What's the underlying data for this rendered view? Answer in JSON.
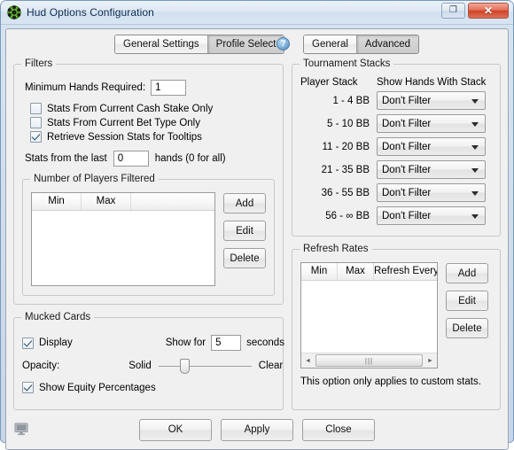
{
  "window": {
    "title": "Hud Options Configuration",
    "app_icon": "green-gear-icon",
    "restore_label": "❐",
    "close_label": "✕"
  },
  "tabs": {
    "left_group": [
      {
        "label": "General Settings",
        "selected": false
      },
      {
        "label": "Profile Select",
        "selected": true
      }
    ],
    "right_group": [
      {
        "label": "General",
        "selected": false
      },
      {
        "label": "Advanced",
        "selected": true
      }
    ],
    "help_label": "?"
  },
  "filters": {
    "legend": "Filters",
    "minimum_hands_label": "Minimum Hands Required:",
    "minimum_hands_value": "1",
    "checkboxes": [
      {
        "label": "Stats From Current Cash Stake Only",
        "checked": false
      },
      {
        "label": "Stats From Current Bet Type Only",
        "checked": false
      },
      {
        "label": "Retrieve Session Stats for Tooltips",
        "checked": true
      }
    ],
    "last_hands_prefix": "Stats from the last",
    "last_hands_value": "0",
    "last_hands_suffix": "hands (0 for all)"
  },
  "players_filtered": {
    "legend": "Number of Players Filtered",
    "columns": [
      "Min",
      "Max",
      ""
    ],
    "rows": [],
    "buttons": [
      "Add",
      "Edit",
      "Delete"
    ]
  },
  "mucked_cards": {
    "legend": "Mucked Cards",
    "display_label": "Display",
    "display_checked": true,
    "show_for_label": "Show for",
    "show_for_value": "5",
    "seconds_label": "seconds",
    "opacity_label": "Opacity:",
    "opacity_min_label": "Solid",
    "opacity_max_label": "Clear",
    "opacity_percent": 28,
    "equity_label": "Show Equity Percentages",
    "equity_checked": true
  },
  "tournament_stacks": {
    "legend": "Tournament Stacks",
    "col_stack_header": "Player Stack",
    "col_filter_header": "Show Hands With Stack",
    "rows": [
      {
        "stack": "1 - 4 BB",
        "filter": "Don't Filter"
      },
      {
        "stack": "5 - 10 BB",
        "filter": "Don't Filter"
      },
      {
        "stack": "11 - 20 BB",
        "filter": "Don't Filter"
      },
      {
        "stack": "21 - 35 BB",
        "filter": "Don't Filter"
      },
      {
        "stack": "36 - 55 BB",
        "filter": "Don't Filter"
      },
      {
        "stack": "56 - ∞ BB",
        "filter": "Don't Filter"
      }
    ]
  },
  "refresh_rates": {
    "legend": "Refresh Rates",
    "columns": [
      "Min",
      "Max",
      "Refresh Every"
    ],
    "rows": [],
    "buttons": [
      "Add",
      "Edit",
      "Delete"
    ],
    "note": "This option only applies to custom stats.",
    "scroll_left_arrow": "◄",
    "scroll_right_arrow": "►",
    "scroll_grip": "|||"
  },
  "footer": {
    "buttons": [
      "OK",
      "Apply",
      "Close"
    ],
    "status_icon": "monitor-icon"
  }
}
